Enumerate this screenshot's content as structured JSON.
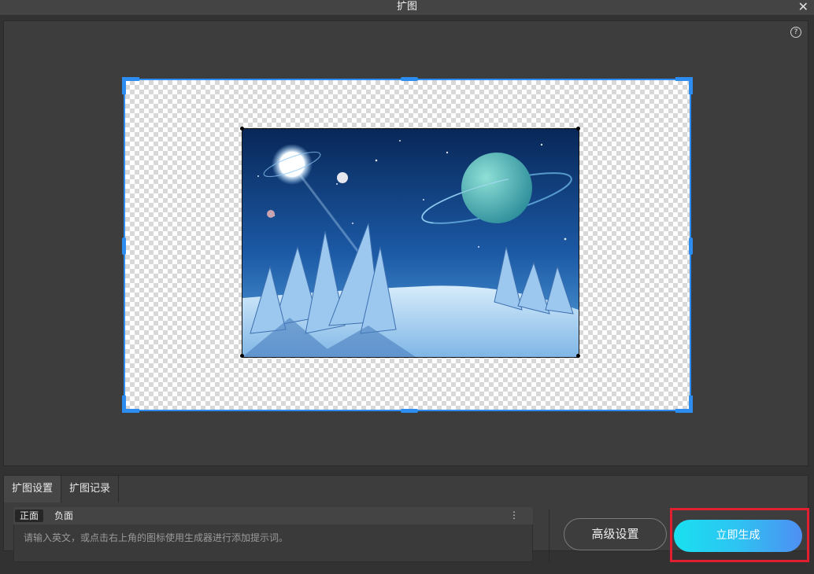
{
  "window": {
    "title": "扩图",
    "close_icon": "close-icon"
  },
  "canvas": {
    "help_icon": "help-icon",
    "help_glyph": "?"
  },
  "tabs": [
    {
      "label": "扩图设置",
      "active": true
    },
    {
      "label": "扩图记录",
      "active": false
    }
  ],
  "prompt": {
    "tab_positive": "正面",
    "tab_negative": "负面",
    "more_icon": "more-vertical-icon",
    "placeholder": "请输入英文，或点击右上角的图标使用生成器进行添加提示词。"
  },
  "actions": {
    "advanced_label": "高级设置",
    "generate_label": "立即生成"
  },
  "colors": {
    "frame": "#2d8cf0",
    "highlight": "#e02030",
    "generate_gradient_start": "#19e0f0",
    "generate_gradient_end": "#4f8ef3"
  }
}
